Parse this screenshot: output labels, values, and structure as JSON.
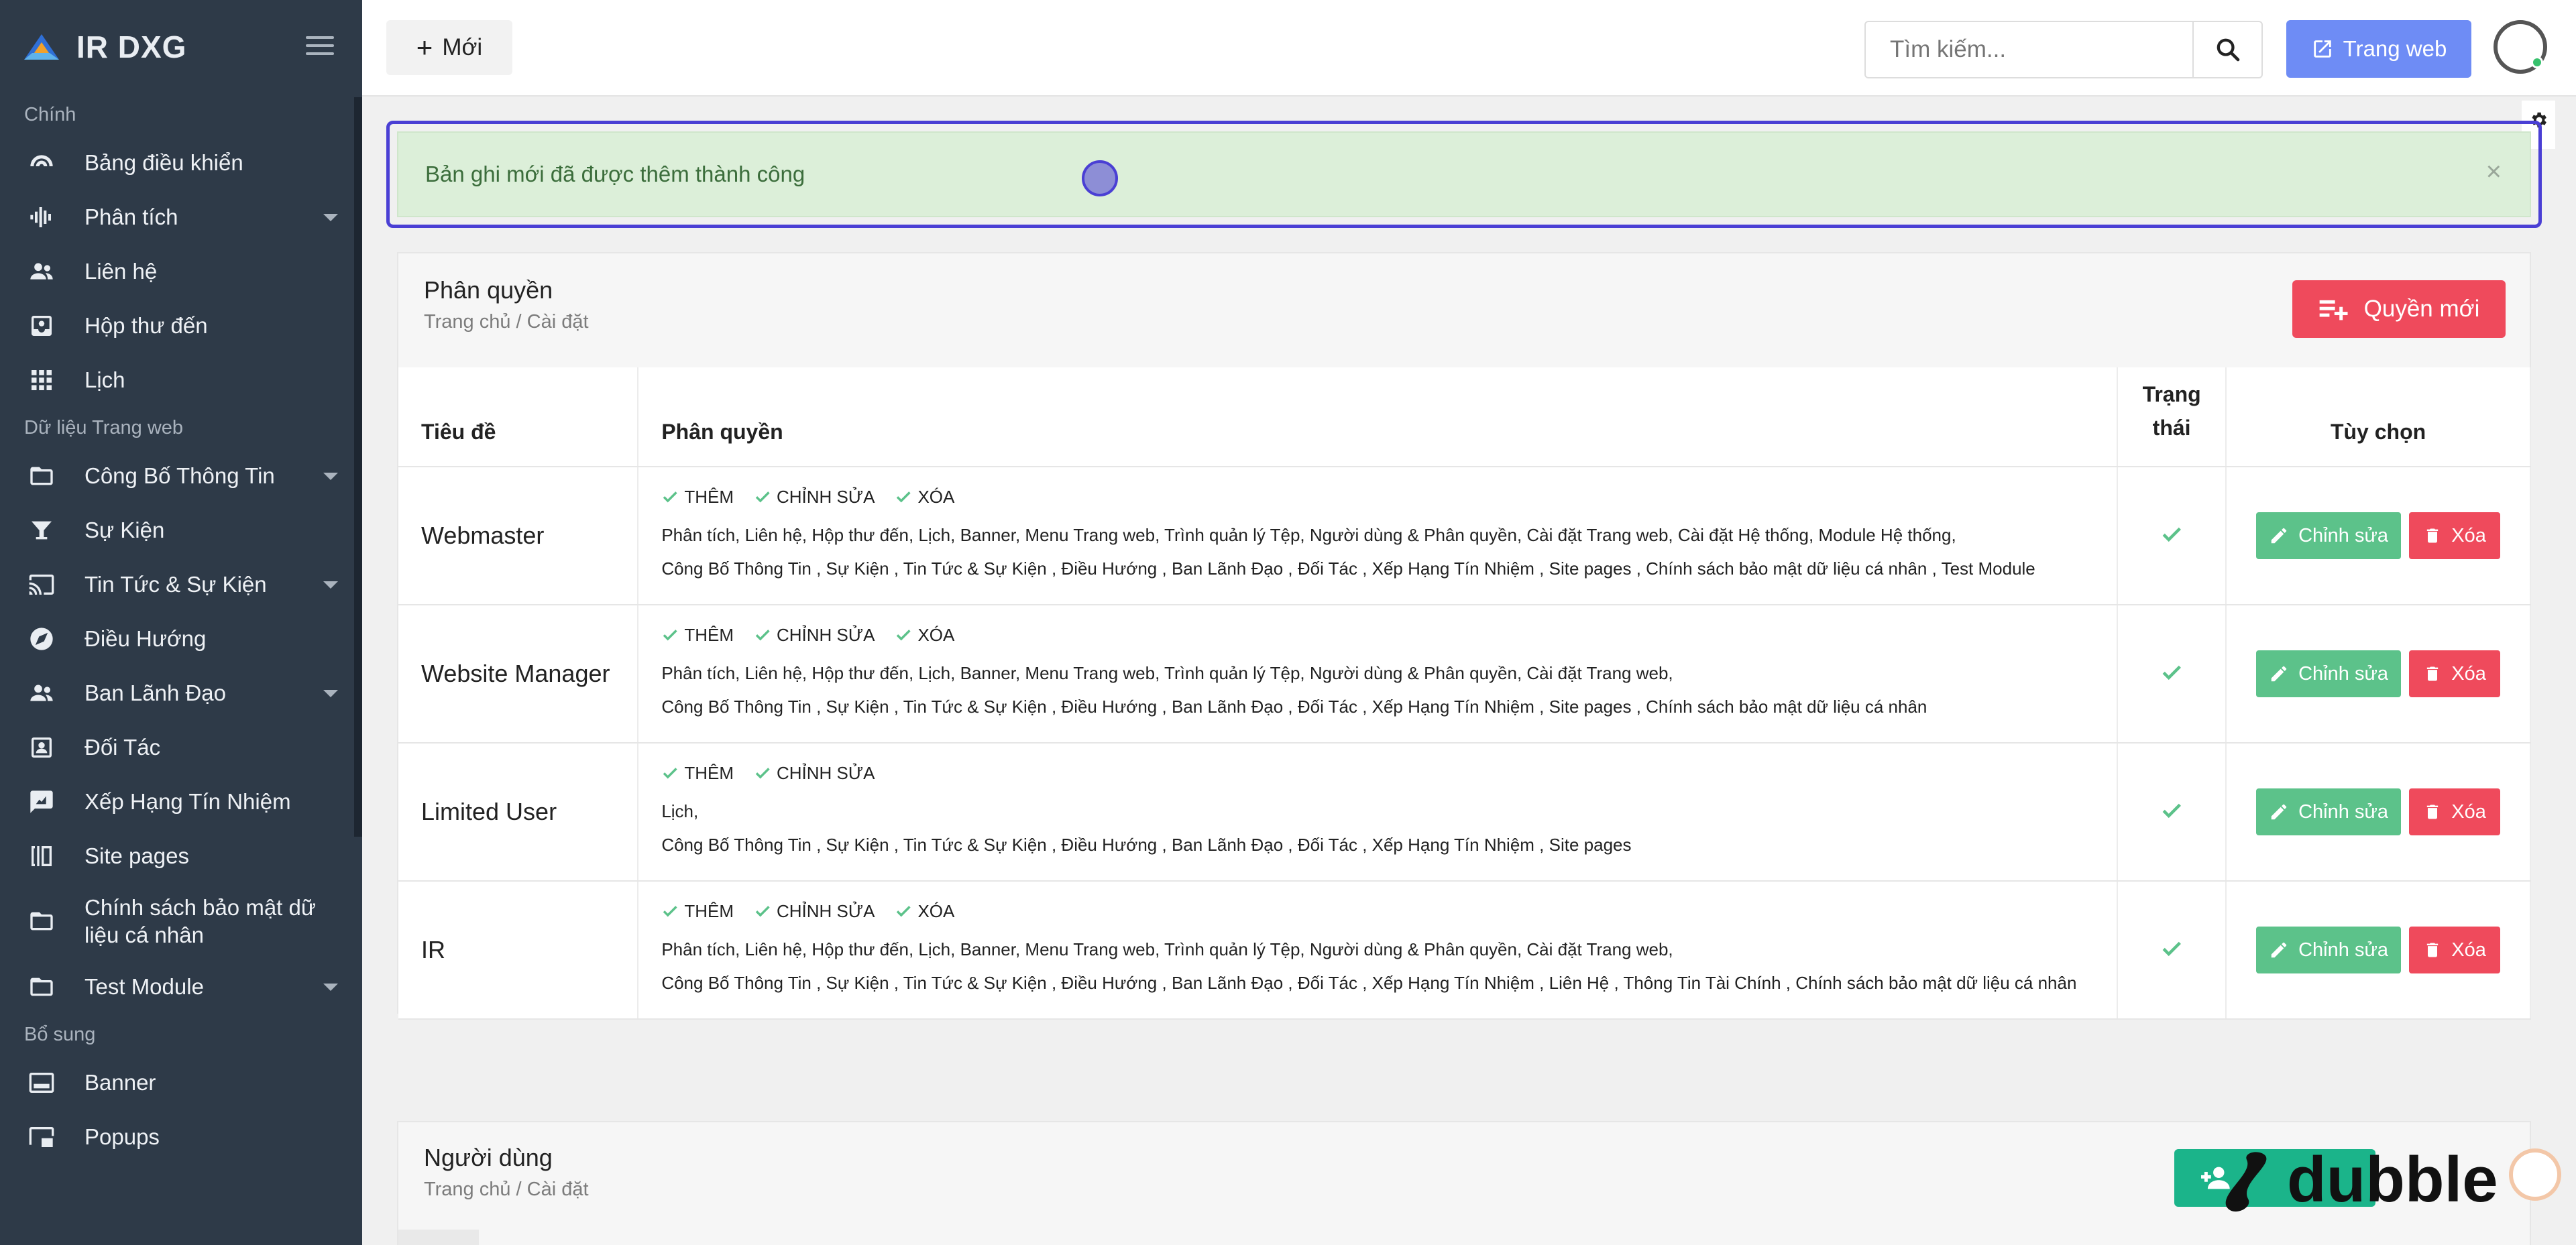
{
  "brand": {
    "name": "IR DXG"
  },
  "sidebar": {
    "sections": [
      {
        "label": "Chính",
        "items": [
          {
            "label": "Bảng điều khiển",
            "icon": "dashboard-icon"
          },
          {
            "label": "Phân tích",
            "icon": "analytics-icon",
            "expandable": true
          },
          {
            "label": "Liên hệ",
            "icon": "contacts-icon"
          },
          {
            "label": "Hộp thư đến",
            "icon": "inbox-icon"
          },
          {
            "label": "Lịch",
            "icon": "calendar-icon"
          }
        ]
      },
      {
        "label": "Dữ liệu Trang web",
        "items": [
          {
            "label": "Công Bố Thông Tin",
            "icon": "folder-icon",
            "expandable": true
          },
          {
            "label": "Sự Kiện",
            "icon": "event-icon"
          },
          {
            "label": "Tin Tức & Sự Kiện",
            "icon": "cast-icon",
            "expandable": true
          },
          {
            "label": "Điều Hướng",
            "icon": "compass-icon"
          },
          {
            "label": "Ban Lãnh Đạo",
            "icon": "people-icon",
            "expandable": true
          },
          {
            "label": "Đối Tác",
            "icon": "partner-icon"
          },
          {
            "label": "Xếp Hạng Tín Nhiệm",
            "icon": "rating-icon"
          },
          {
            "label": "Site pages",
            "icon": "pages-icon"
          },
          {
            "label": "Chính sách bảo mật dữ liệu cá nhân",
            "icon": "folder-icon"
          },
          {
            "label": "Test Module",
            "icon": "folder-icon",
            "expandable": true
          }
        ]
      },
      {
        "label": "Bổ sung",
        "items": [
          {
            "label": "Banner",
            "icon": "banner-icon"
          },
          {
            "label": "Popups",
            "icon": "popup-icon"
          }
        ]
      }
    ]
  },
  "topbar": {
    "new_label": "Mới",
    "search_placeholder": "Tìm kiếm...",
    "website_label": "Trang web"
  },
  "alert": {
    "message": "Bản ghi mới đã được thêm thành công",
    "close": "×"
  },
  "permissions": {
    "title": "Phân quyền",
    "breadcrumb": "Trang chủ / Cài đặt",
    "new_button": "Quyền mới",
    "columns": {
      "title": "Tiêu đề",
      "permissions": "Phân quyền",
      "status": "Trạng thái",
      "options": "Tùy chọn"
    },
    "edit_label": "Chỉnh sửa",
    "delete_label": "Xóa",
    "rows": [
      {
        "title": "Webmaster",
        "flags": [
          "THÊM",
          "CHỈNH SỬA",
          "XÓA"
        ],
        "line1": "Phân tích, Liên hệ, Hộp thư đến, Lịch, Banner, Menu Trang web, Trình quản lý Tệp, Người dùng & Phân quyền, Cài đặt Trang web, Cài đặt Hệ thống, Module Hệ thống,",
        "line2": "Công Bố Thông Tin , Sự Kiện , Tin Tức & Sự Kiện , Điều Hướng , Ban Lãnh Đạo , Đối Tác , Xếp Hạng Tín Nhiệm , Site pages , Chính sách bảo mật dữ liệu cá nhân , Test Module"
      },
      {
        "title": "Website Manager",
        "flags": [
          "THÊM",
          "CHỈNH SỬA",
          "XÓA"
        ],
        "line1": "Phân tích, Liên hệ, Hộp thư đến, Lịch, Banner, Menu Trang web, Trình quản lý Tệp, Người dùng & Phân quyền, Cài đặt Trang web,",
        "line2": "Công Bố Thông Tin , Sự Kiện , Tin Tức & Sự Kiện , Điều Hướng , Ban Lãnh Đạo , Đối Tác , Xếp Hạng Tín Nhiệm , Site pages , Chính sách bảo mật dữ liệu cá nhân"
      },
      {
        "title": "Limited User",
        "flags": [
          "THÊM",
          "CHỈNH SỬA"
        ],
        "line1": "Lịch,",
        "line2": "Công Bố Thông Tin , Sự Kiện , Tin Tức & Sự Kiện , Điều Hướng , Ban Lãnh Đạo , Đối Tác , Xếp Hạng Tín Nhiệm , Site pages"
      },
      {
        "title": "IR",
        "flags": [
          "THÊM",
          "CHỈNH SỬA",
          "XÓA"
        ],
        "line1": "Phân tích, Liên hệ, Hộp thư đến, Lịch, Banner, Menu Trang web, Trình quản lý Tệp, Người dùng & Phân quyền, Cài đặt Trang web,",
        "line2": "Công Bố Thông Tin , Sự Kiện , Tin Tức & Sự Kiện , Điều Hướng , Ban Lãnh Đạo , Đối Tác , Xếp Hạng Tín Nhiệm , Liên Hệ , Thông Tin Tài Chính , Chính sách bảo mật dữ liệu cá nhân"
      }
    ]
  },
  "users": {
    "title": "Người dùng",
    "breadcrumb": "Trang chủ / Cài đặt"
  },
  "watermark": {
    "text": "dubble"
  },
  "colors": {
    "sidebar": "#2e3a48",
    "accent": "#6e8cf5",
    "danger": "#ef4a5c",
    "success": "#5cc28a",
    "alert_bg": "#dcefd9"
  }
}
